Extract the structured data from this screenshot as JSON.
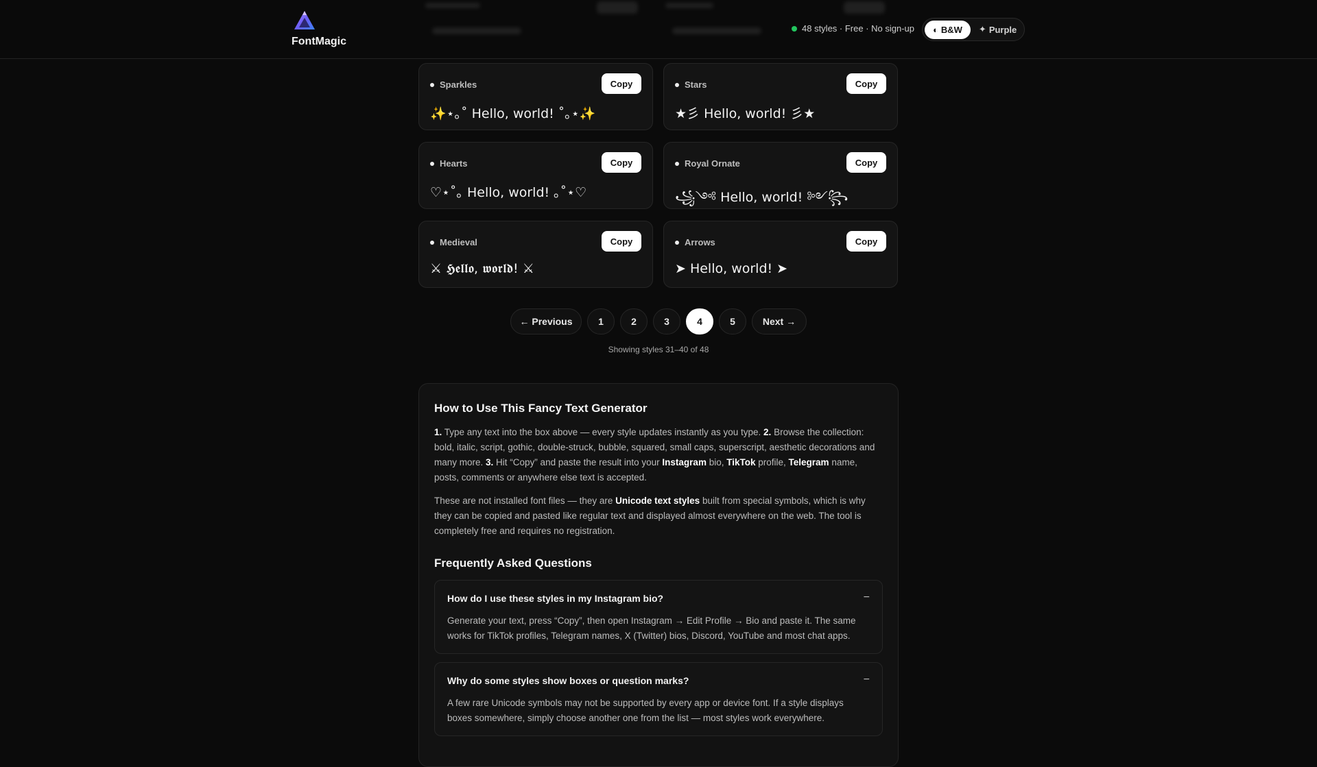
{
  "header": {
    "brand_name": "FontMagic",
    "status_text": "48 styles · Free · No sign-up",
    "theme_bw_label": "B&W",
    "theme_purple_label": "Purple",
    "theme_bw_icon": "◐",
    "theme_purple_icon": "✦"
  },
  "cards": [
    {
      "name": "Sparkles",
      "sample": "✨⋆｡˚ Hello, world! ˚｡⋆✨",
      "copy_label": "Copy"
    },
    {
      "name": "Stars",
      "sample": "★彡 Hello, world! 彡★",
      "copy_label": "Copy"
    },
    {
      "name": "Hearts",
      "sample": "♡⋆˚｡ Hello, world! ｡˚⋆♡",
      "copy_label": "Copy"
    },
    {
      "name": "Royal Ornate",
      "sample": "꧁༺ Hello, world! ༻꧂",
      "copy_label": "Copy"
    },
    {
      "name": "Medieval",
      "sample": "⚔ 𝕳𝖊𝖑𝖑𝖔, 𝖜𝖔𝖗𝖑𝖉! ⚔",
      "copy_label": "Copy"
    },
    {
      "name": "Arrows",
      "sample": "➤ Hello, world! ➤",
      "copy_label": "Copy"
    }
  ],
  "pagination": {
    "previous_label": "← Previous",
    "next_label": "Next →",
    "pages": [
      "1",
      "2",
      "3",
      "4",
      "5"
    ],
    "current_page": "4",
    "showing_text": "Showing styles 31–40 of 48"
  },
  "info": {
    "title": "How to Use This Fancy Text Generator",
    "step1_num": "1.",
    "step1_text": " Type any text into the box above — every style updates instantly as you type. ",
    "step2_num": "2.",
    "step2_text": " Browse the collection: bold, italic, script, gothic, double-struck, bubble, squared, small caps, superscript, aesthetic decorations and many more. ",
    "step3_num": "3.",
    "step3_text_a": " Hit “Copy” and paste the result into your ",
    "instagram": "Instagram",
    "step3_text_b": " bio, ",
    "tiktok": "TikTok",
    "step3_text_c": " profile, ",
    "telegram": "Telegram",
    "step3_text_d": " name, posts, comments or anywhere else text is accepted.",
    "para2_a": "These are not installed font files — they are ",
    "para2_bold": "Unicode text styles",
    "para2_b": " built from special symbols, which is why they can be copied and pasted like regular text and displayed almost everywhere on the web. The tool is completely free and requires no registration.",
    "faq_title": "Frequently Asked Questions",
    "faqs": [
      {
        "question": "How do I use these styles in my Instagram bio?",
        "answer": "Generate your text, press “Copy”, then open Instagram → Edit Profile → Bio and paste it. The same works for TikTok profiles, Telegram names, X (Twitter) bios, Discord, YouTube and most chat apps.",
        "toggle": "−"
      },
      {
        "question": "Why do some styles show boxes or question marks?",
        "answer": "A few rare Unicode symbols may not be supported by every app or device font. If a style displays boxes somewhere, simply choose another one from the list — most styles work everywhere.",
        "toggle": "−"
      }
    ]
  }
}
